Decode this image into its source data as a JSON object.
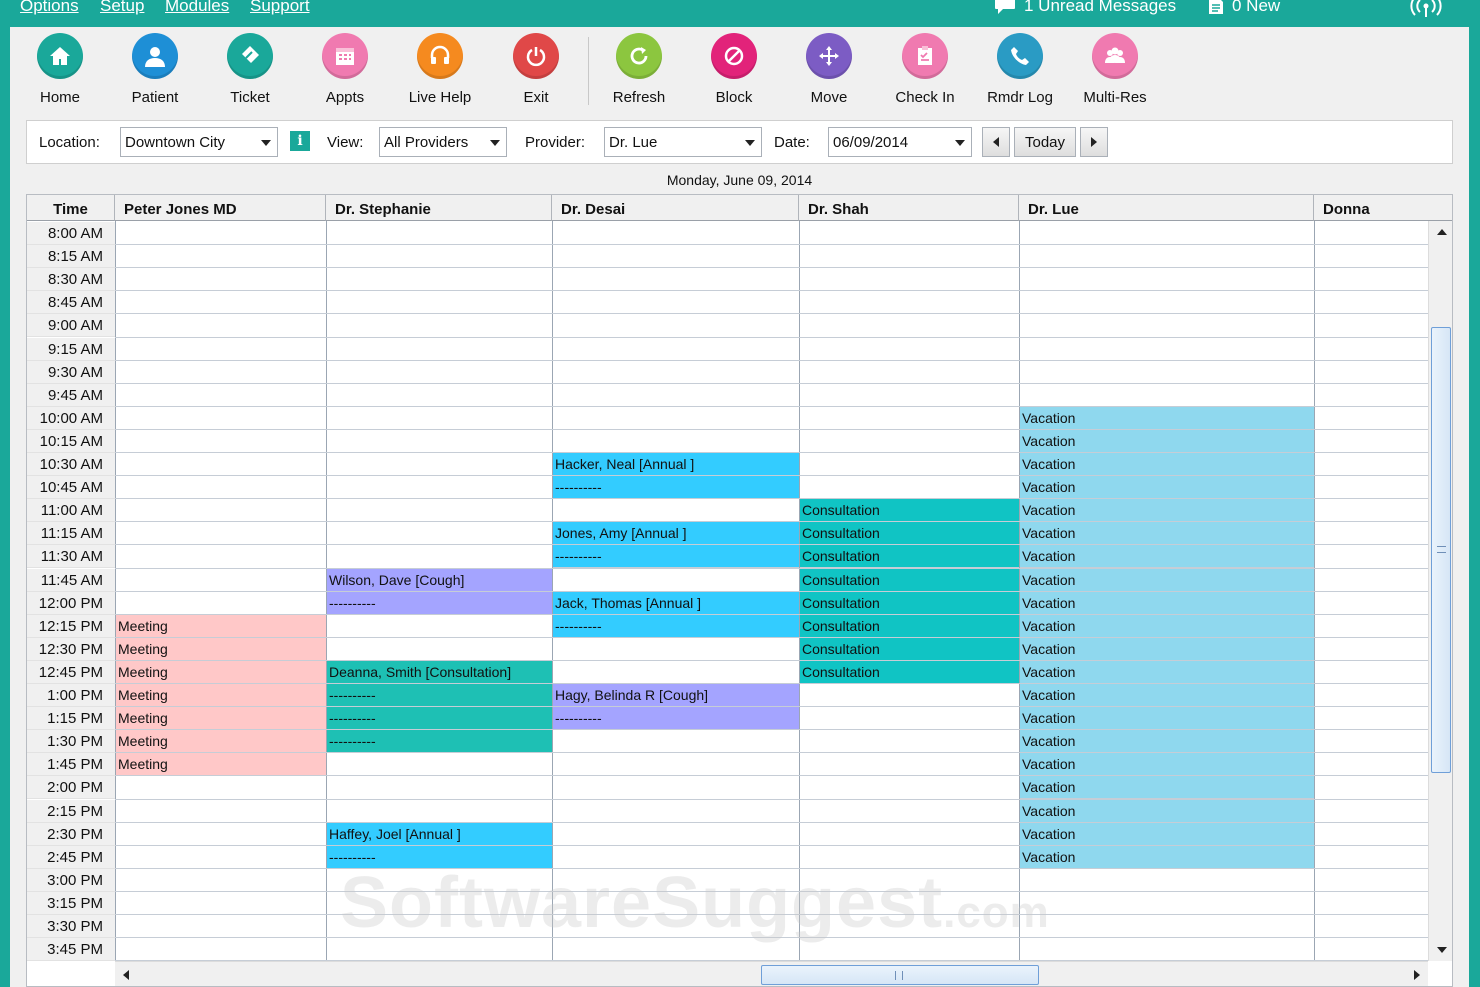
{
  "menu": [
    "Options",
    "Setup",
    "Modules",
    "Support"
  ],
  "status": {
    "unread_messages": "1 Unread Messages",
    "new_docs": "0 New"
  },
  "toolbar": [
    {
      "key": "home",
      "label": "Home",
      "color": "#1aa89a"
    },
    {
      "key": "patient",
      "label": "Patient",
      "color": "#1e8fd6"
    },
    {
      "key": "ticket",
      "label": "Ticket",
      "color": "#1aa89a"
    },
    {
      "key": "appts",
      "label": "Appts",
      "color": "#f07ab0"
    },
    {
      "key": "livehelp",
      "label": "Live Help",
      "color": "#f58a1f"
    },
    {
      "key": "exit",
      "label": "Exit",
      "color": "#e04848"
    },
    {
      "key": "refresh",
      "label": "Refresh",
      "color": "#8cc63f"
    },
    {
      "key": "block",
      "label": "Block",
      "color": "#e2237a"
    },
    {
      "key": "move",
      "label": "Move",
      "color": "#7c5cc4"
    },
    {
      "key": "checkin",
      "label": "Check In",
      "color": "#f07ab0"
    },
    {
      "key": "rmdrlog",
      "label": "Rmdr Log",
      "color": "#2a9bc4"
    },
    {
      "key": "multires",
      "label": "Multi-Res",
      "color": "#f07ab0"
    }
  ],
  "filters": {
    "location_label": "Location:",
    "location_value": "Downtown City",
    "view_label": "View:",
    "view_value": "All Providers",
    "provider_label": "Provider:",
    "provider_value": "Dr. Lue",
    "date_label": "Date:",
    "date_value": "06/09/2014",
    "today_label": "Today"
  },
  "date_heading": "Monday, June 09, 2014",
  "grid": {
    "time_header": "Time",
    "providers": [
      "Peter Jones MD",
      "Dr. Stephanie",
      "Dr. Desai",
      "Dr. Shah",
      "Dr. Lue",
      "Donna"
    ],
    "times": [
      "8:00 AM",
      "8:15 AM",
      "8:30 AM",
      "8:45 AM",
      "9:00 AM",
      "9:15 AM",
      "9:30 AM",
      "9:45 AM",
      "10:00 AM",
      "10:15 AM",
      "10:30 AM",
      "10:45 AM",
      "11:00 AM",
      "11:15 AM",
      "11:30 AM",
      "11:45 AM",
      "12:00 PM",
      "12:15 PM",
      "12:30 PM",
      "12:45 PM",
      "1:00 PM",
      "1:15 PM",
      "1:30 PM",
      "1:45 PM",
      "2:00 PM",
      "2:15 PM",
      "2:30 PM",
      "2:45 PM",
      "3:00 PM",
      "3:15 PM",
      "3:30 PM",
      "3:45 PM"
    ],
    "appointments": [
      {
        "col": 0,
        "rows": [
          17,
          18,
          19,
          20,
          21,
          22,
          23
        ],
        "text": "Meeting",
        "repeat": true,
        "color": "#ffc8c8"
      },
      {
        "col": 1,
        "start": 15,
        "len": 2,
        "text": "Wilson, Dave   [Cough]",
        "color": "#a4a4ff"
      },
      {
        "col": 1,
        "start": 19,
        "len": 4,
        "text": "Deanna, Smith   [Consultation]",
        "color": "#1ec0b4"
      },
      {
        "col": 1,
        "start": 26,
        "len": 2,
        "text": "Haffey, Joel   [Annual ]",
        "color": "#33ccff"
      },
      {
        "col": 2,
        "start": 10,
        "len": 2,
        "text": "Hacker, Neal   [Annual ]",
        "color": "#33ccff"
      },
      {
        "col": 2,
        "start": 13,
        "len": 2,
        "text": "Jones, Amy   [Annual ]",
        "color": "#33ccff"
      },
      {
        "col": 2,
        "start": 16,
        "len": 2,
        "text": "Jack, Thomas   [Annual ]",
        "color": "#33ccff"
      },
      {
        "col": 2,
        "start": 20,
        "len": 2,
        "text": "Hagy, Belinda R  [Cough]",
        "color": "#a4a4ff"
      },
      {
        "col": 3,
        "rows": [
          12,
          13,
          14,
          15,
          16,
          17,
          18,
          19
        ],
        "text": "Consultation",
        "repeat": true,
        "color": "#10c4c4"
      },
      {
        "col": 4,
        "rows": [
          8,
          9,
          10,
          11,
          12,
          13,
          14,
          15,
          16,
          17,
          18,
          19,
          20,
          21,
          22,
          23,
          24,
          25,
          26,
          27
        ],
        "text": "Vacation",
        "repeat": true,
        "color": "#8fd8ee"
      }
    ]
  }
}
